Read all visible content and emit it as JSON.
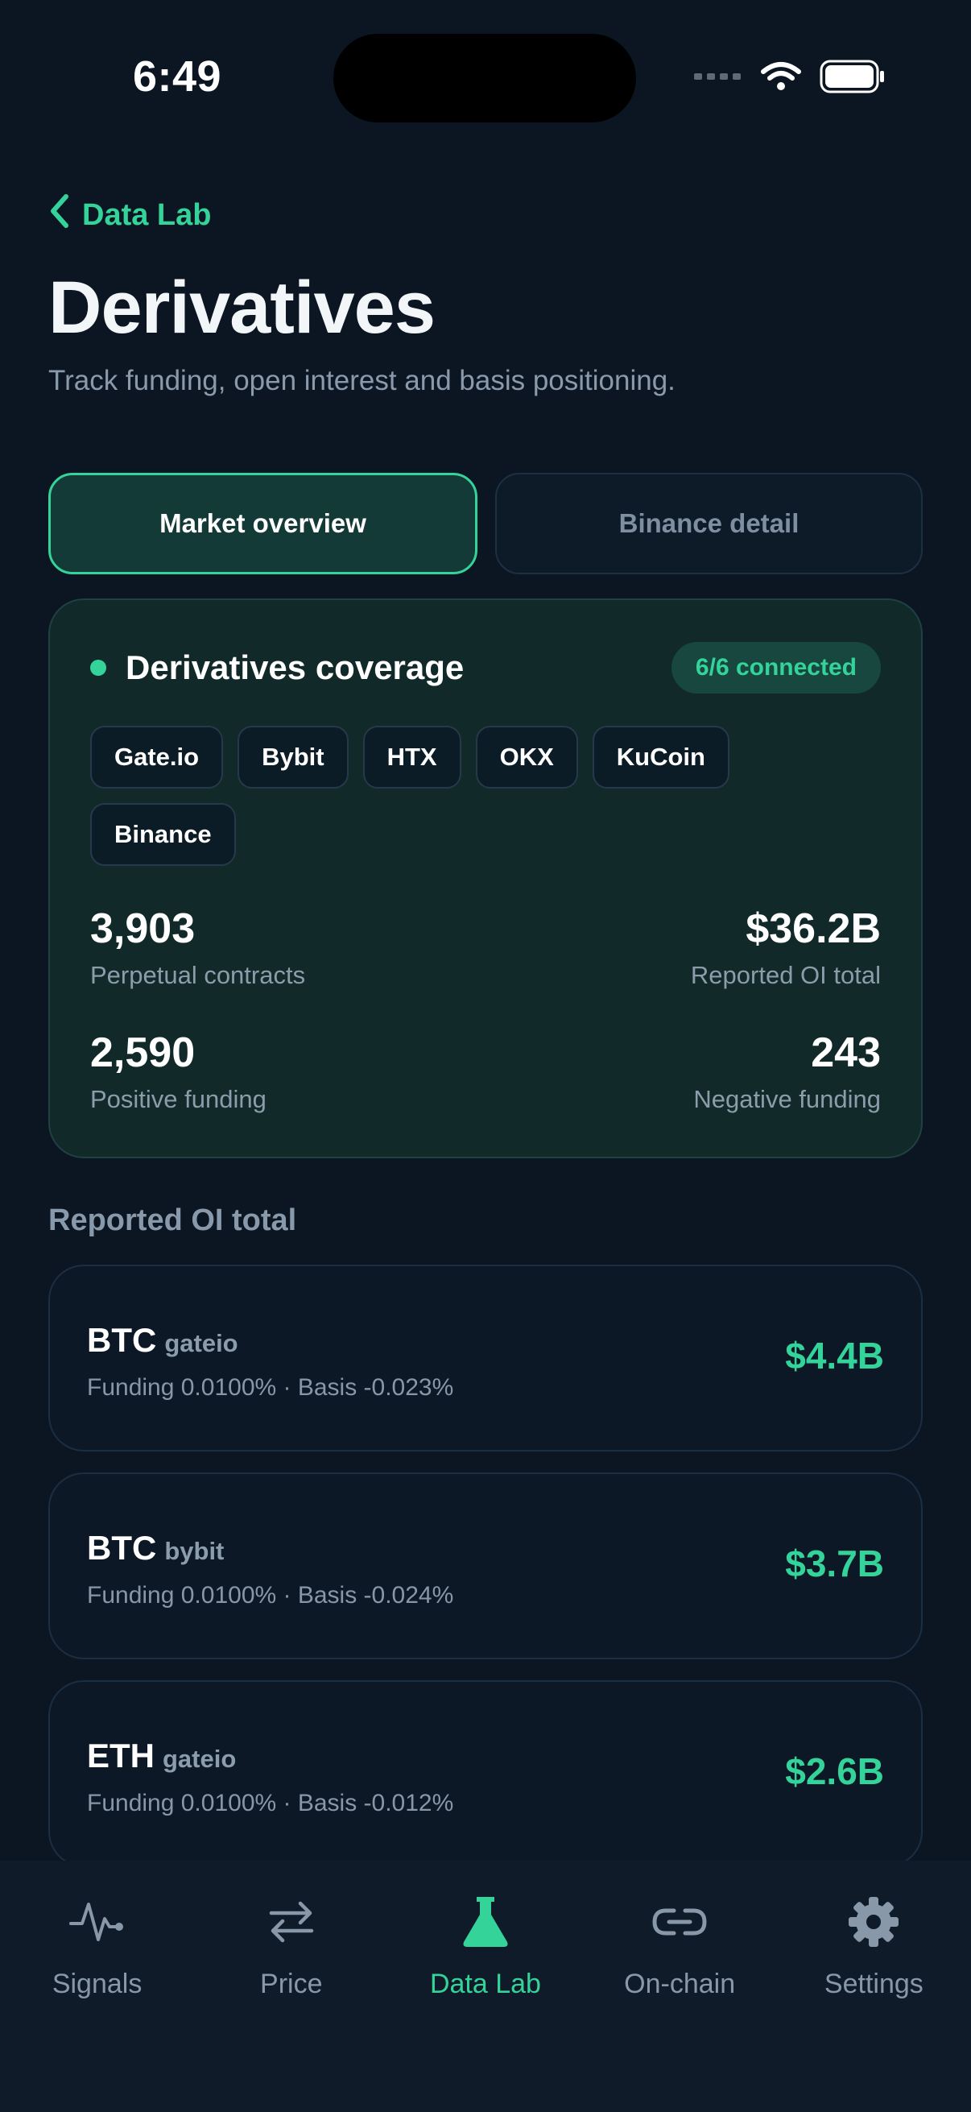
{
  "status_bar": {
    "time": "6:49"
  },
  "nav": {
    "back_label": "Data Lab"
  },
  "page": {
    "title": "Derivatives",
    "subtitle": "Track funding, open interest and basis positioning."
  },
  "segments": [
    {
      "label": "Market overview",
      "active": true
    },
    {
      "label": "Binance detail",
      "active": false
    }
  ],
  "coverage": {
    "title": "Derivatives coverage",
    "badge": "6/6 connected",
    "exchanges": [
      "Gate.io",
      "Bybit",
      "HTX",
      "OKX",
      "KuCoin",
      "Binance"
    ],
    "stats": {
      "perpetual_contracts": {
        "value": "3,903",
        "label": "Perpetual contracts"
      },
      "reported_oi_total": {
        "value": "$36.2B",
        "label": "Reported OI total"
      },
      "positive_funding": {
        "value": "2,590",
        "label": "Positive funding"
      },
      "negative_funding": {
        "value": "243",
        "label": "Negative funding"
      }
    }
  },
  "section": {
    "title": "Reported OI total"
  },
  "oi_rows": [
    {
      "symbol": "BTC",
      "exchange": "gateio",
      "meta": "Funding 0.0100% · Basis -0.023%",
      "value": "$4.4B"
    },
    {
      "symbol": "BTC",
      "exchange": "bybit",
      "meta": "Funding 0.0100% · Basis -0.024%",
      "value": "$3.7B"
    },
    {
      "symbol": "ETH",
      "exchange": "gateio",
      "meta": "Funding 0.0100% · Basis -0.012%",
      "value": "$2.6B"
    }
  ],
  "tab_bar": {
    "items": [
      {
        "label": "Signals",
        "icon": "pulse-icon",
        "active": false
      },
      {
        "label": "Price",
        "icon": "swap-arrows-icon",
        "active": false
      },
      {
        "label": "Data Lab",
        "icon": "flask-icon",
        "active": true
      },
      {
        "label": "On-chain",
        "icon": "link-icon",
        "active": false
      },
      {
        "label": "Settings",
        "icon": "gear-icon",
        "active": false
      }
    ]
  },
  "colors": {
    "accent": "#34d399",
    "background": "#0b1622",
    "card": "#0d1826",
    "coverage_card": "#112a29"
  }
}
